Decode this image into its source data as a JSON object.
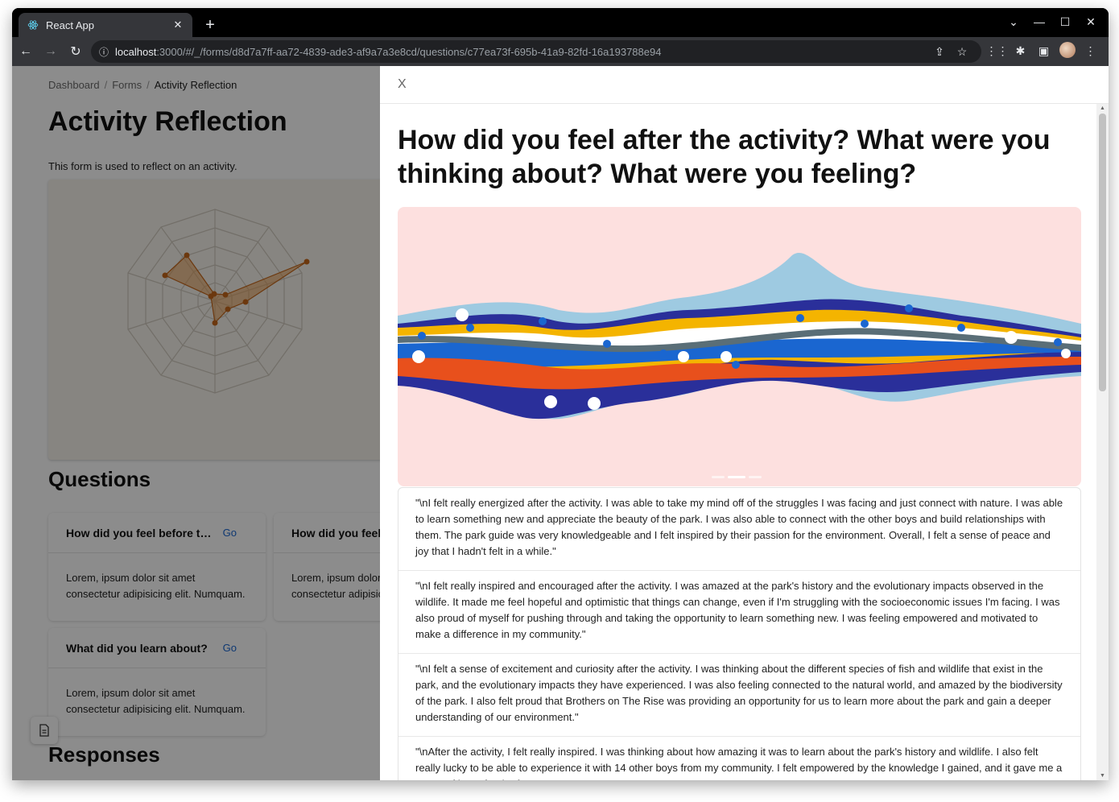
{
  "browser": {
    "tab_title": "React App",
    "tab_close": "✕",
    "new_tab": "+",
    "url_host": "localhost",
    "url_rest": ":3000/#/_/forms/d8d7a7ff-aa72-4839-ade3-af9a7a3e8cd/questions/c77ea73f-695b-41a9-82fd-16a193788e94"
  },
  "page": {
    "breadcrumb": [
      "Dashboard",
      "Forms",
      "Activity Reflection"
    ],
    "breadcrumb_sep": "/",
    "title": "Activity Reflection",
    "description": "This form is used to reflect on an activity.",
    "questions_heading": "Questions",
    "responses_heading": "Responses",
    "go_label": "Go",
    "cards": [
      {
        "title": "How did you feel before the activity?",
        "body": "Lorem, ipsum dolor sit amet consectetur adipisicing elit. Numquam."
      },
      {
        "title": "How did you feel after the activity?",
        "body": "Lorem, ipsum dolor sit amet consectetur adipisicing elit. Numquam."
      },
      {
        "title": "What did you learn about?",
        "body": "Lorem, ipsum dolor sit amet consectetur adipisicing elit. Numquam."
      }
    ]
  },
  "drawer": {
    "close_label": "X",
    "question": "How did you feel after the activity? What were you thinking about? What were you feeling?",
    "responses": [
      "\"\\nI felt really energized after the activity. I was able to take my mind off of the struggles I was facing and just connect with nature. I was able to learn something new and appreciate the beauty of the park. I was also able to connect with the other boys and build relationships with them. The park guide was very knowledgeable and I felt inspired by their passion for the environment. Overall, I felt a sense of peace and joy that I hadn't felt in a while.\"",
      "\"\\nI felt really inspired and encouraged after the activity. I was amazed at the park's history and the evolutionary impacts observed in the wildlife. It made me feel hopeful and optimistic that things can change, even if I'm struggling with the socioeconomic issues I'm facing. I was also proud of myself for pushing through and taking the opportunity to learn something new. I was feeling empowered and motivated to make a difference in my community.\"",
      "\"\\nI felt a sense of excitement and curiosity after the activity. I was thinking about the different species of fish and wildlife that exist in the park, and the evolutionary impacts they have experienced. I was also feeling connected to the natural world, and amazed by the biodiversity of the park. I also felt proud that Brothers on The Rise was providing an opportunity for us to learn more about the park and gain a deeper understanding of our environment.\"",
      "\"\\nAfter the activity, I felt really inspired. I was thinking about how amazing it was to learn about the park's history and wildlife. I also felt really lucky to be able to experience it with 14 other boys from my community. I felt empowered by the knowledge I gained, and it gave me a sense of hope for the future.\""
    ]
  },
  "colors": {
    "accent": "#1a66d0",
    "hero_bg": "#fde0df",
    "radar_fill": "#e89a4f",
    "radar_stroke": "#c5661a"
  },
  "icons": [
    "react-icon",
    "close-icon",
    "plus-icon",
    "minimize-icon",
    "maximize-icon",
    "back-icon",
    "forward-icon",
    "reload-icon",
    "info-icon",
    "share-icon",
    "star-icon",
    "extensions-icon",
    "sidepanel-icon",
    "menu-icon",
    "document-icon"
  ]
}
